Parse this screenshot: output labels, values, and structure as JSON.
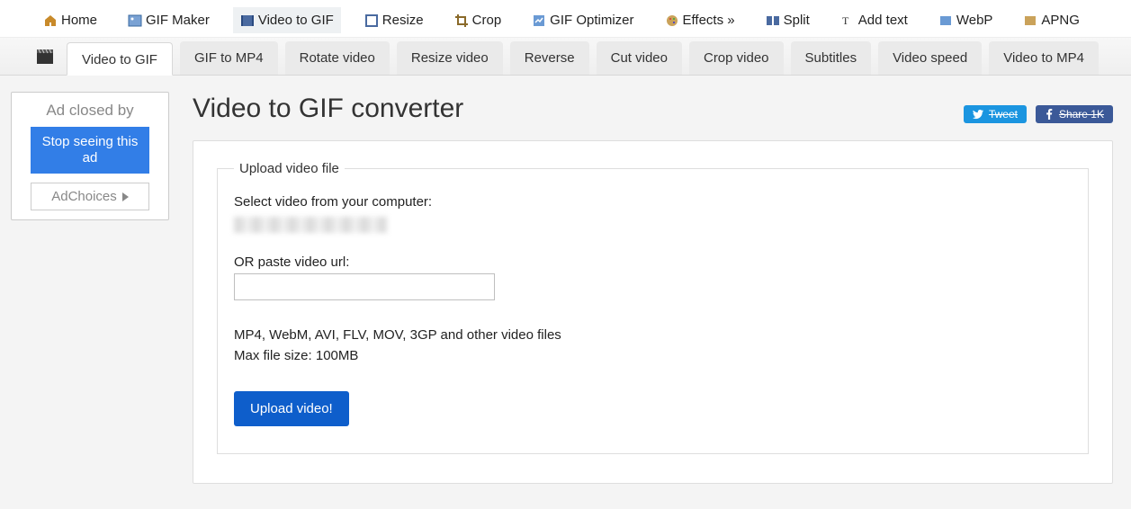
{
  "topnav": {
    "items": [
      {
        "label": "Home"
      },
      {
        "label": "GIF Maker"
      },
      {
        "label": "Video to GIF",
        "active": true
      },
      {
        "label": "Resize"
      },
      {
        "label": "Crop"
      },
      {
        "label": "GIF Optimizer"
      },
      {
        "label": "Effects »"
      },
      {
        "label": "Split"
      },
      {
        "label": "Add text"
      },
      {
        "label": "WebP"
      },
      {
        "label": "APNG"
      }
    ]
  },
  "subnav": {
    "items": [
      {
        "label": "Video to GIF",
        "active": true
      },
      {
        "label": "GIF to MP4"
      },
      {
        "label": "Rotate video"
      },
      {
        "label": "Resize video"
      },
      {
        "label": "Reverse"
      },
      {
        "label": "Cut video"
      },
      {
        "label": "Crop video"
      },
      {
        "label": "Subtitles"
      },
      {
        "label": "Video speed"
      },
      {
        "label": "Video to MP4"
      }
    ]
  },
  "ad": {
    "closed_text": "Ad closed by",
    "stop_label": "Stop seeing this ad",
    "choices_label": "AdChoices"
  },
  "page": {
    "title": "Video to GIF converter",
    "tweet_label": "Tweet",
    "fb_label": "Share 1K"
  },
  "form": {
    "legend": "Upload video file",
    "select_label": "Select video from your computer:",
    "url_label": "OR paste video url:",
    "url_value": "",
    "helper_line1": "MP4, WebM, AVI, FLV, MOV, 3GP and other video files",
    "helper_line2": "Max file size: 100MB",
    "submit_label": "Upload video!"
  }
}
